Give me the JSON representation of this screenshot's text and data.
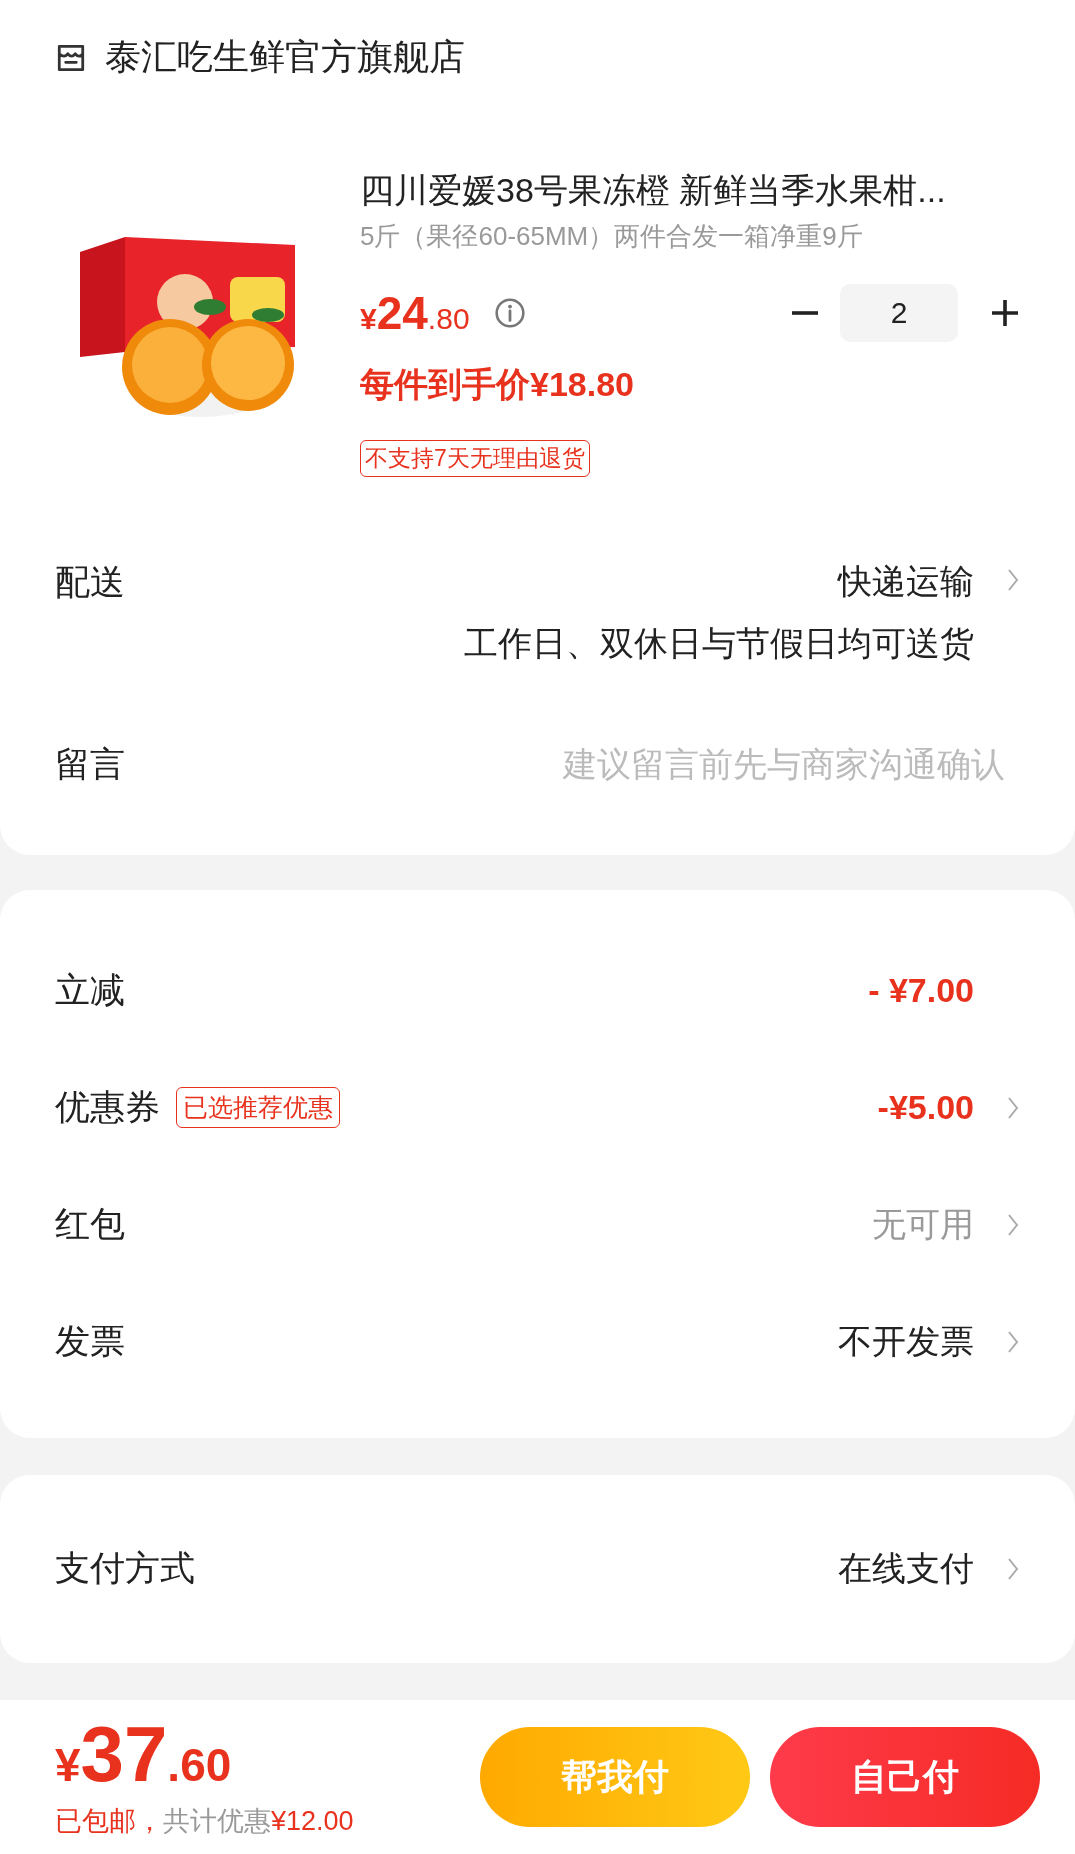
{
  "store": {
    "name": "泰汇吃生鲜官方旗舰店"
  },
  "product": {
    "title": "四川爱媛38号果冻橙 新鲜当季水果柑...",
    "spec": "5斤（果径60-65MM）两件合发一箱净重9斤",
    "price_symbol": "¥",
    "price_int": "24",
    "price_dec": ".80",
    "net_price": "每件到手价¥18.80",
    "quantity": "2",
    "tag": "不支持7天无理由退货"
  },
  "delivery": {
    "label": "配送",
    "value": "快递运输",
    "note": "工作日、双休日与节假日均可送货"
  },
  "message": {
    "label": "留言",
    "placeholder": "建议留言前先与商家沟通确认"
  },
  "discounts": [
    {
      "label": "立减",
      "value": "- ¥7.00",
      "color": "#e8321e",
      "emphasis": true,
      "chevron": false
    },
    {
      "label": "优惠券",
      "badge": "已选推荐优惠",
      "value": "-¥5.00",
      "color": "#e8321e",
      "emphasis": true,
      "chevron": true
    },
    {
      "label": "红包",
      "value": "无可用",
      "color": "#999999",
      "emphasis": false,
      "chevron": true
    },
    {
      "label": "发票",
      "value": "不开发票",
      "color": "#222222",
      "emphasis": false,
      "chevron": true
    }
  ],
  "payment": {
    "label": "支付方式",
    "value": "在线支付"
  },
  "footer": {
    "symbol": "¥",
    "int": "37",
    "dec": ".60",
    "note": [
      {
        "text": "已包邮，",
        "color": "#e8321e"
      },
      {
        "text": "共计优惠",
        "color": "#999999"
      },
      {
        "text": "¥12.00",
        "color": "#e8321e"
      }
    ],
    "buttons": [
      {
        "label": "帮我付",
        "kind": "friend"
      },
      {
        "label": "自己付",
        "kind": "self"
      }
    ]
  }
}
